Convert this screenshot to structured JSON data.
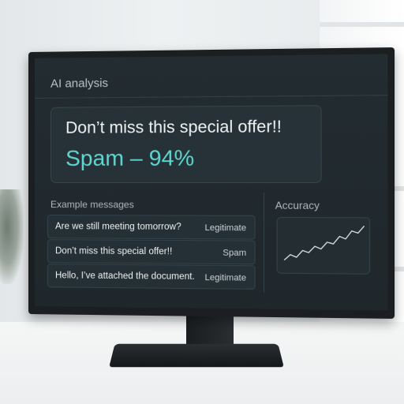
{
  "app": {
    "title": "AI analysis"
  },
  "result": {
    "message": "Don’t miss this special offer!!",
    "verdict": "Spam – 94%"
  },
  "examples": {
    "heading": "Example messages",
    "items": [
      {
        "text": "Are we still meeting tomorrow?",
        "label": "Legitimate"
      },
      {
        "text": "Don’t miss this special offer!!",
        "label": "Spam"
      },
      {
        "text": "Hello, I’ve attached the document.",
        "label": "Legitimate"
      }
    ]
  },
  "accuracy": {
    "heading": "Accuracy",
    "trend": [
      0.15,
      0.28,
      0.22,
      0.38,
      0.33,
      0.48,
      0.42,
      0.58,
      0.54,
      0.72,
      0.66,
      0.85,
      0.8,
      0.97
    ],
    "line_color": "#e6ecee"
  },
  "colors": {
    "accent": "#5fd6cf",
    "screen_bg": "#1f272b"
  }
}
